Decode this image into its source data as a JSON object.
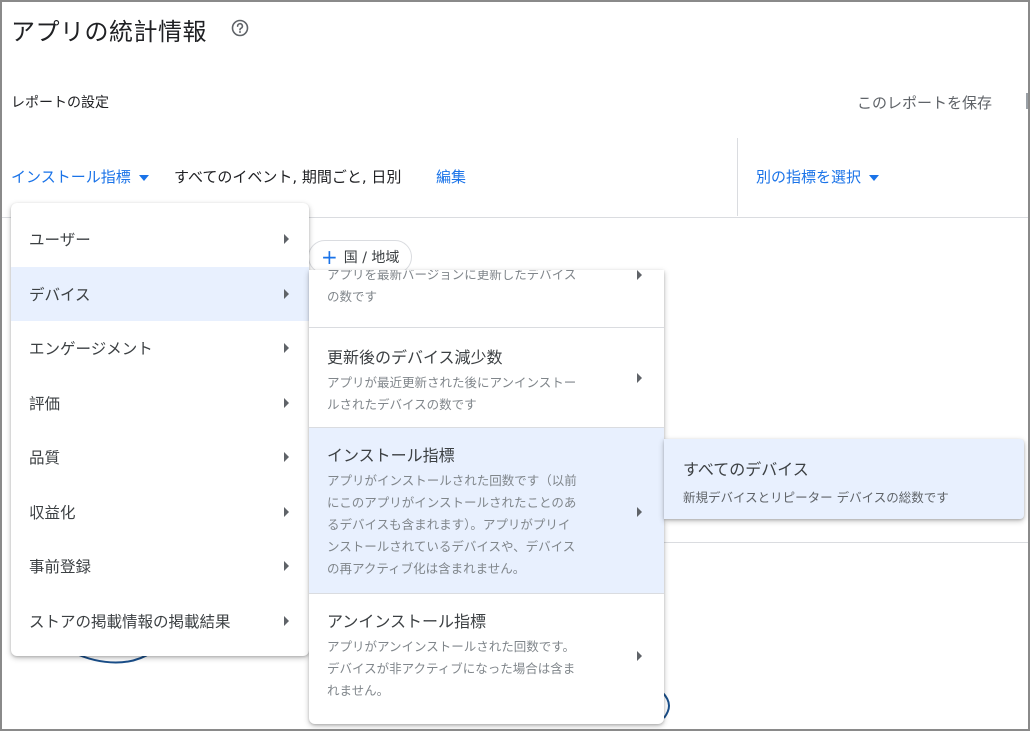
{
  "page": {
    "title": "アプリの統計情報",
    "help_icon": "help-circle-icon"
  },
  "report": {
    "settings_label": "レポートの設定",
    "save_label": "このレポートを保存"
  },
  "metric_bar": {
    "metric_label": "インストール指標",
    "description": "すべてのイベント, 期間ごと, 日別",
    "edit_label": "編集",
    "other_metric_label": "別の指標を選択"
  },
  "filter_chip": {
    "label": "国 / 地域",
    "icon": "plus-icon"
  },
  "menu_level1": {
    "items": [
      {
        "label": "ユーザー"
      },
      {
        "label": "デバイス"
      },
      {
        "label": "エンゲージメント"
      },
      {
        "label": "評価"
      },
      {
        "label": "品質"
      },
      {
        "label": "収益化"
      },
      {
        "label": "事前登録"
      },
      {
        "label": "ストアの掲載情報の掲載結果"
      }
    ],
    "active_index": 1
  },
  "menu_level2": {
    "items": [
      {
        "title": "",
        "desc": "アプリを最新バージョンに更新したデバイスの数です",
        "desc_lines": [
          "アプリを最新バージョンに更新したデバイス",
          "の数です"
        ]
      },
      {
        "title": "更新後のデバイス減少数",
        "desc_lines": [
          "アプリが最近更新された後にアンインストー",
          "ルされたデバイスの数です"
        ]
      },
      {
        "title": "インストール指標",
        "desc_lines": [
          "アプリがインストールされた回数です（以前",
          "にこのアプリがインストールされたことのあ",
          "るデバイスも含まれます）。アプリがプリイ",
          "ンストールされているデバイスや、デバイス",
          "の再アクティブ化は含まれません。"
        ]
      },
      {
        "title": "アンインストール指標",
        "desc_lines": [
          "アプリがアンインストールされた回数です。",
          "デバイスが非アクティブになった場合は含ま",
          "れません。"
        ]
      }
    ],
    "active_index": 2
  },
  "menu_level3": {
    "title": "すべてのデバイス",
    "desc": "新規デバイスとリピーター デバイスの総数です"
  },
  "colors": {
    "accent": "#1a73e8",
    "active_bg": "#e8f0fe",
    "text": "#3c4043",
    "muted": "#80868b"
  }
}
